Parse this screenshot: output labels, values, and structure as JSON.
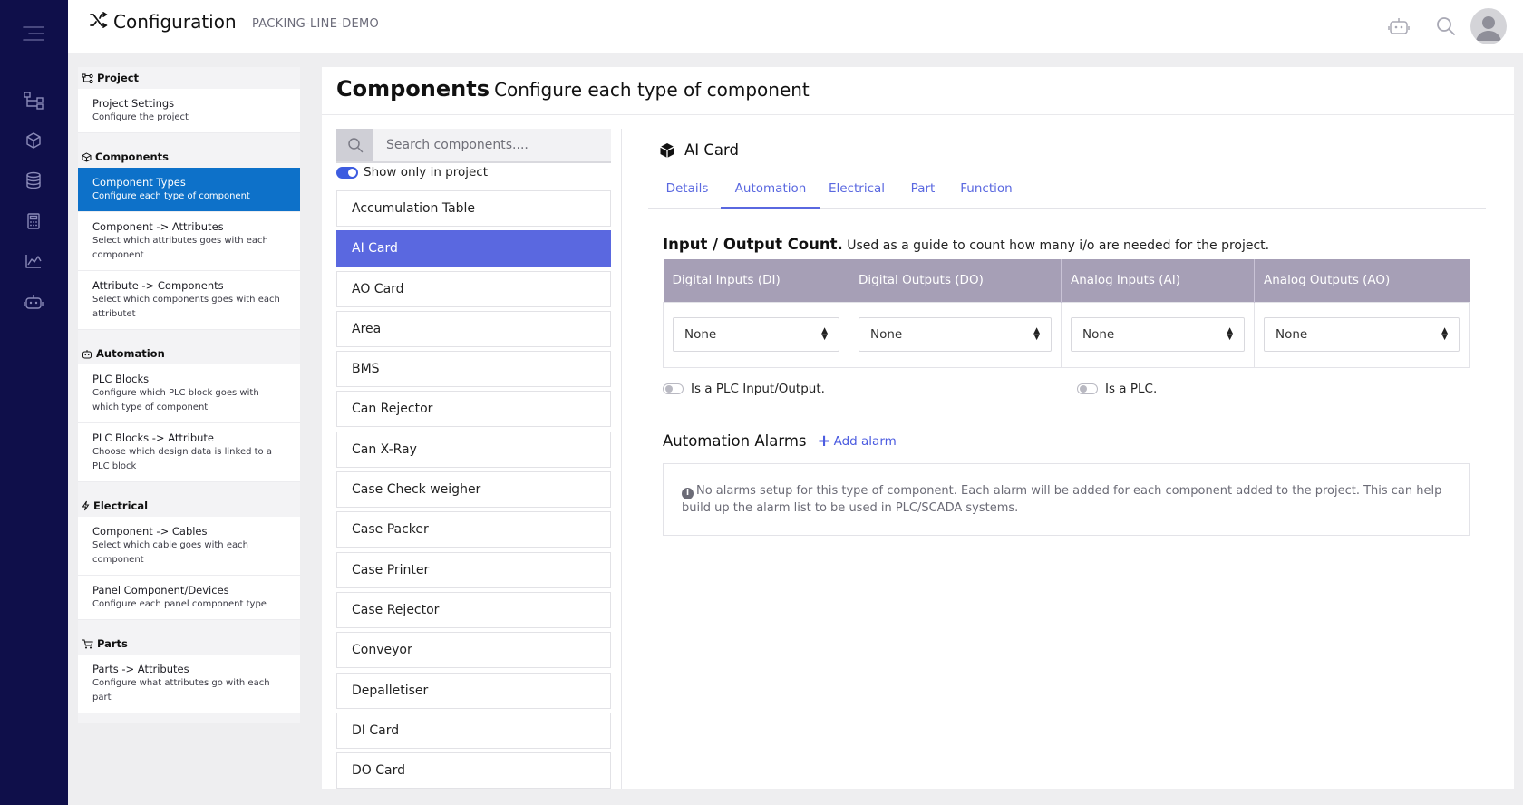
{
  "app": {
    "title": "Configuration",
    "project": "PACKING-LINE-DEMO"
  },
  "rail_icons": [
    "menu-icon",
    "hierarchy-icon",
    "cube-icon",
    "database-icon",
    "calculator-icon",
    "chart-icon",
    "robot-icon"
  ],
  "topbar_icons": [
    "robot-icon",
    "search-icon",
    "avatar"
  ],
  "nav": {
    "sections": [
      {
        "title": "Project",
        "icon": "hierarchy-icon",
        "items": [
          {
            "title": "Project Settings",
            "subtitle": "Configure the project",
            "active": false
          }
        ]
      },
      {
        "title": "Components",
        "icon": "cube-icon",
        "items": [
          {
            "title": "Component Types",
            "subtitle": "Configure each type of component",
            "active": true
          },
          {
            "title": "Component -> Attributes",
            "subtitle": "Select which attributes goes with each component",
            "active": false
          },
          {
            "title": "Attribute -> Components",
            "subtitle": "Select which components goes with each attributet",
            "active": false
          }
        ]
      },
      {
        "title": "Automation",
        "icon": "robot-icon",
        "items": [
          {
            "title": "PLC Blocks",
            "subtitle": "Configure which PLC block goes with which type of component",
            "active": false
          },
          {
            "title": "PLC Blocks -> Attribute",
            "subtitle": "Choose which design data is linked to a PLC block",
            "active": false
          }
        ]
      },
      {
        "title": "Electrical",
        "icon": "bolt-icon",
        "items": [
          {
            "title": "Component -> Cables",
            "subtitle": "Select which cable goes with each component",
            "active": false
          },
          {
            "title": "Panel Component/Devices",
            "subtitle": "Configure each panel component type",
            "active": false
          }
        ]
      },
      {
        "title": "Parts",
        "icon": "cart-icon",
        "items": [
          {
            "title": "Parts -> Attributes",
            "subtitle": "Configure what attributes go with each part",
            "active": false
          }
        ]
      }
    ]
  },
  "main": {
    "title": "Components",
    "subtitle": "Configure each type of component"
  },
  "component_list": {
    "search_placeholder": "Search components....",
    "show_only_label": "Show only in project",
    "items": [
      "Accumulation Table",
      "AI Card",
      "AO Card",
      "Area",
      "BMS",
      "Can Rejector",
      "Can X-Ray",
      "Case Check weigher",
      "Case Packer",
      "Case Printer",
      "Case Rejector",
      "Conveyor",
      "Depalletiser",
      "DI Card",
      "DO Card"
    ],
    "selected": "AI Card"
  },
  "detail": {
    "title": "AI Card",
    "tabs": [
      "Details",
      "Automation",
      "Electrical",
      "Part",
      "Function"
    ],
    "active_tab": "Automation",
    "io": {
      "heading": "Input / Output Count.",
      "description": "Used as a guide to count how many i/o are needed for the project.",
      "columns": [
        "Digital Inputs (DI)",
        "Digital Outputs (DO)",
        "Analog Inputs (AI)",
        "Analog Outputs (AO)"
      ],
      "values": [
        "None",
        "None",
        "None",
        "None"
      ]
    },
    "is_plc_io_label": "Is a PLC Input/Output.",
    "is_plc_label": "Is a PLC.",
    "alarms": {
      "title": "Automation Alarms",
      "add_label": "Add alarm",
      "empty_message": "No alarms setup for this type of component. Each alarm will be added for each component added to the project. This can help build up the alarm list to be used in PLC/SCADA systems."
    }
  },
  "colors": {
    "rail": "#0f0f4a",
    "nav_active": "#0d71c9",
    "list_active": "#5a68e0",
    "table_header": "#a69fb6",
    "accent": "#4c5ce0"
  }
}
